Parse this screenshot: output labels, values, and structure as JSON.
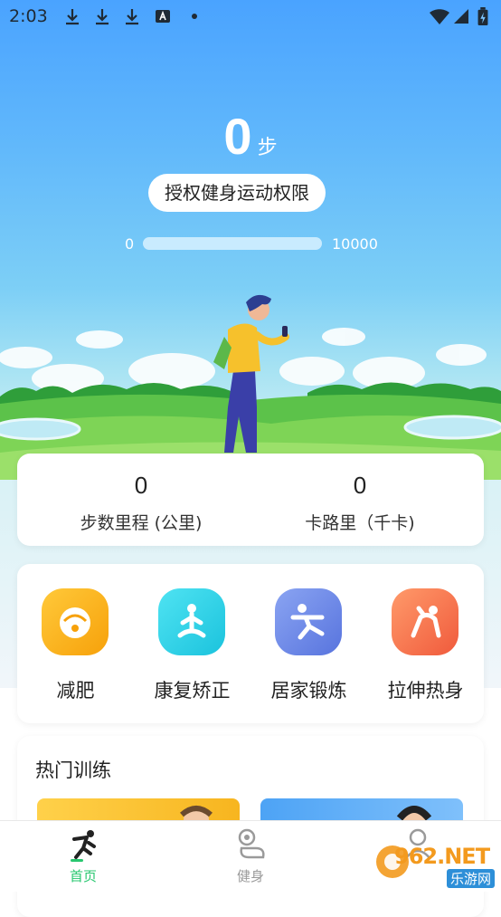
{
  "status_bar": {
    "time": "2:03",
    "icons": [
      "download-icon",
      "download-icon",
      "download-icon",
      "keyboard-icon",
      "dot-icon",
      "wifi-icon",
      "signal-icon",
      "battery-charging-icon"
    ]
  },
  "steps": {
    "count": "0",
    "unit": "步",
    "auth_button": "授权健身运动权限",
    "progress_min": "0",
    "progress_max": "10000",
    "progress_fraction": 0
  },
  "stats": [
    {
      "value": "0",
      "label": "步数里程 (公里)"
    },
    {
      "value": "0",
      "label": "卡路里（千卡)"
    }
  ],
  "categories": [
    {
      "label": "减肥",
      "icon": "scale-icon",
      "color": "#f9b30e"
    },
    {
      "label": "康复矫正",
      "icon": "meditation-icon",
      "color": "#2fd3e8"
    },
    {
      "label": "居家锻炼",
      "icon": "stretch-pose-icon",
      "color": "#6a86e6"
    },
    {
      "label": "拉伸热身",
      "icon": "yoga-arch-icon",
      "color": "#f7734f"
    }
  ],
  "hot": {
    "title": "热门训练"
  },
  "tabbar": {
    "items": [
      {
        "label": "首页",
        "icon": "running-icon",
        "active": true
      },
      {
        "label": "健身",
        "icon": "fitness-icon",
        "active": false
      },
      {
        "label": "",
        "icon": "profile-icon",
        "active": false
      }
    ],
    "active_color": "#28c76f",
    "inactive_color": "#9a9a9a"
  },
  "watermark": {
    "brand": "962.NET",
    "caption": "乐游网"
  }
}
